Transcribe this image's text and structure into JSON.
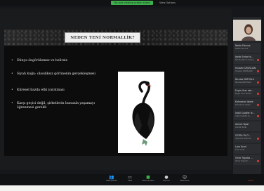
{
  "top_bar": {
    "share_notice": "You are viewing screen share",
    "view_options": "View Options"
  },
  "slide": {
    "title": "NEDEN YENİ NORMALLİK?",
    "bullets": [
      "Dünya öngörülemez ve belirsiz",
      "Siyah kuğu: olasılıksız görünenin gerçekleşmesi",
      "Küresel bazda etki yaratması",
      "Karşı geçici değil, şirketlerin bununla yaşamayı öğrenmesi gerekli"
    ]
  },
  "participants": [
    {
      "name": "Nadia Piscova",
      "sub": "Nadia Piscova"
    },
    {
      "name": "Jacob Scripe Is...",
      "sub": "Set Bu Mic Lo Scripe"
    },
    {
      "name": "Hussein DROSLIAN",
      "sub": "Hussein DROSLIAN"
    },
    {
      "name": "Nicolas MATOGLU",
      "sub": "Nicolas MATOGLU"
    },
    {
      "name": "Engin Ucar aka...",
      "sub": "Engin Ucar aka E..."
    },
    {
      "name": "Kahraman Iskele",
      "sub": "Kahraman Iskele"
    },
    {
      "name": "Irabil Sudafer Ie...",
      "sub": "Irabil Sudafer Ie..."
    },
    {
      "name": "Ahmet Topal",
      "sub": "Ahmet Topal"
    },
    {
      "name": "CEYDA YILCI...",
      "sub": "Ayshane Kosmosi"
    },
    {
      "name": "Lara Yucel",
      "sub": "Lara Yucel"
    },
    {
      "name": "Omer Topaloz ...",
      "sub": "Omer Topaloz ..."
    }
  ],
  "toolbar": {
    "participants_label": "Participants",
    "chat_label": "Chat",
    "share_label": "Share Screen",
    "record_label": "Record",
    "reactions_label": "Reactions",
    "leave_label": "Leave"
  },
  "colors": {
    "share_green": "#3fae4c",
    "muted_red": "#d23c2f"
  },
  "icons": [
    "participants-icon",
    "chat-icon",
    "share-screen-icon",
    "record-icon",
    "reactions-icon",
    "leave-icon",
    "black-swan-image"
  ]
}
